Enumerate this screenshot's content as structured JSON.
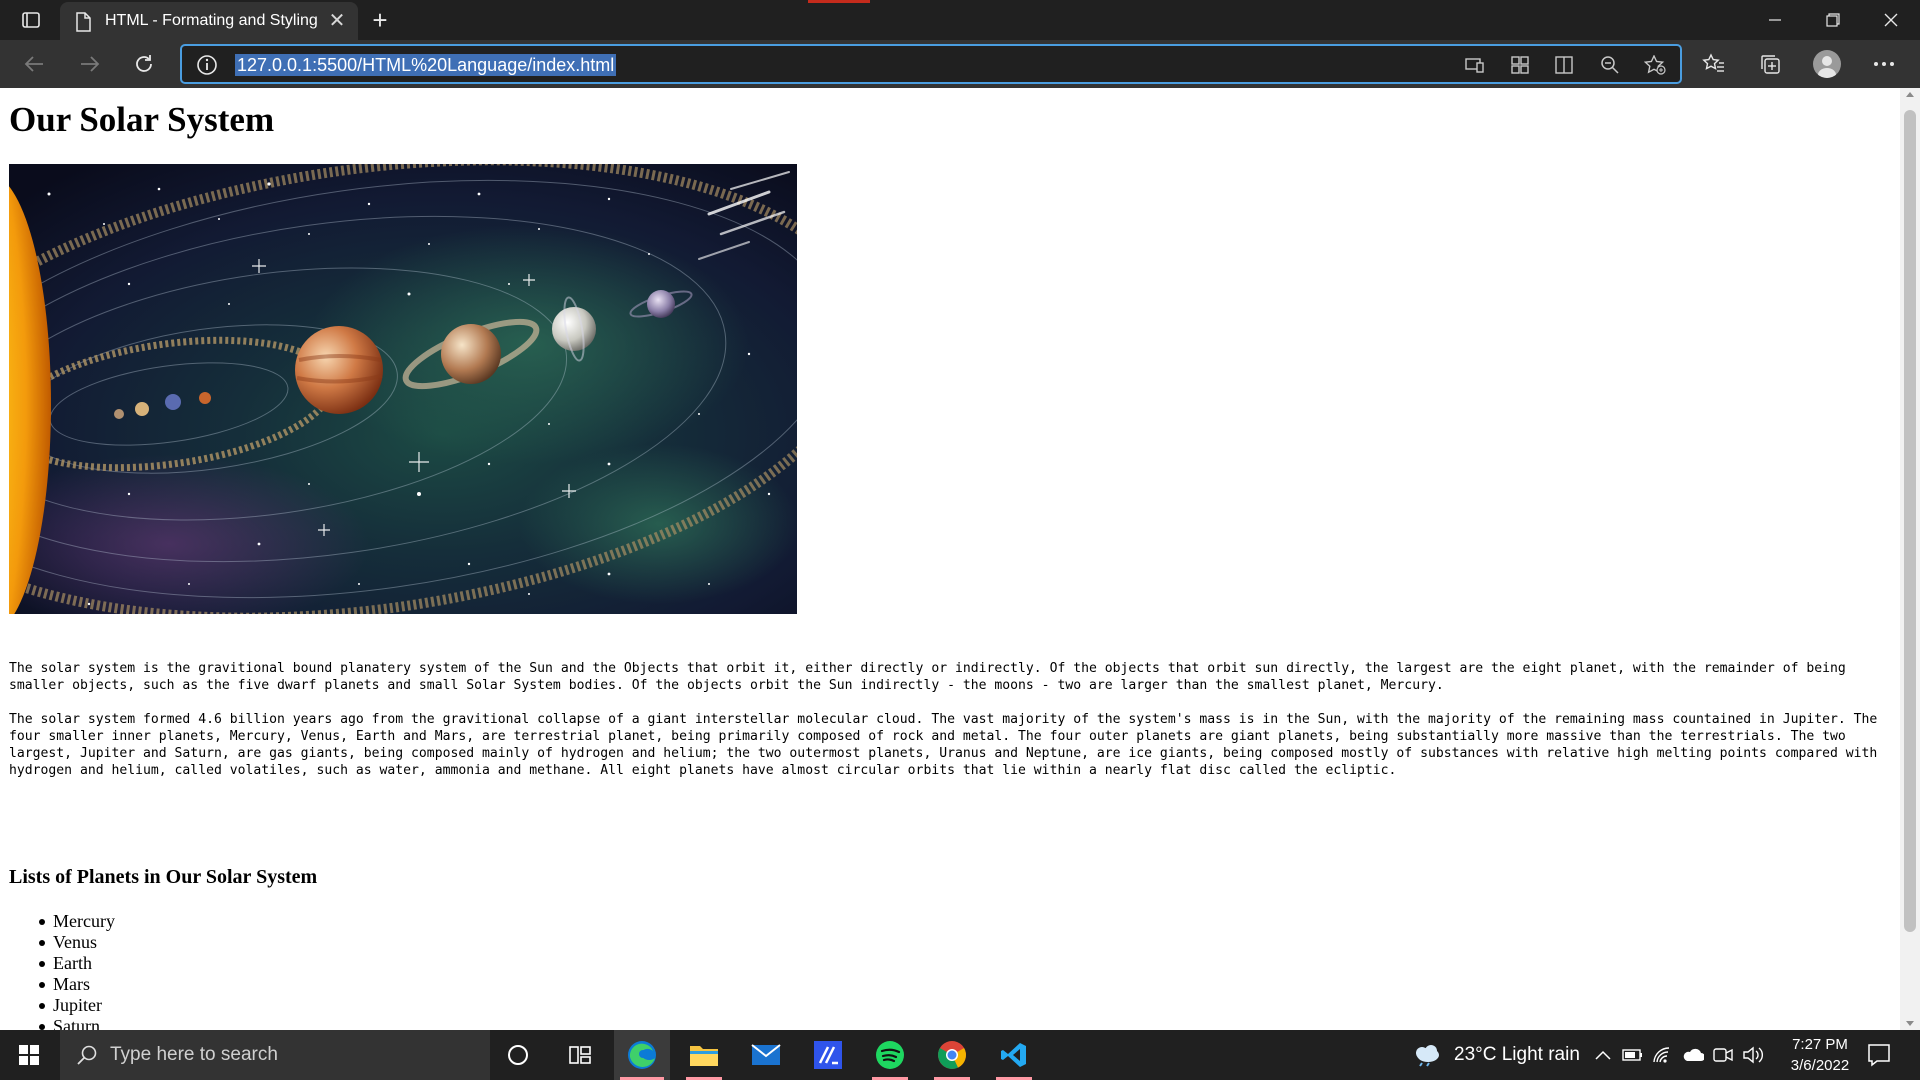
{
  "browser": {
    "tab_title": "HTML - Formating and Styling",
    "tab_close": "✕",
    "new_tab": "+",
    "url": "127.0.0.1:5500/HTML%20Language/index.html"
  },
  "page": {
    "title": "Our Solar System",
    "paragraphs": [
      "The solar system is the gravitional bound planatery system of the Sun and the Objects that orbit it, either directly or indirectly. Of the objects that orbit sun directly, the largest are the eight planet, with the remainder of being smaller objects, such as the five dwarf planets and small Solar System bodies. Of the objects orbit the Sun indirectly - the moons - two are larger than the smallest planet, Mercury.",
      "The solar system formed 4.6 billion years ago from the gravitional collapse of a giant interstellar molecular cloud. The vast majority of the system's mass is in the Sun, with the majority of the remaining mass countained in Jupiter. The four smaller inner planets, Mercury, Venus, Earth and Mars, are terrestrial planet, being primarily composed of rock and metal. The four outer planets are giant planets, being substantially more massive than the terrestrials. The two largest, Jupiter and Saturn, are gas giants, being composed mainly of hydrogen and helium; the two outermost planets, Uranus and Neptune, are ice giants, being composed mostly of substances with relative high melting points compared with hydrogen and helium, called volatiles, such as water, ammonia and methane. All eight planets have almost circular orbits that lie within a nearly flat disc called the ecliptic."
    ],
    "list_heading": "Lists of Planets in Our Solar System",
    "planets": [
      "Mercury",
      "Venus",
      "Earth",
      "Mars",
      "Jupiter",
      "Saturn"
    ]
  },
  "taskbar": {
    "search_placeholder": "Type here to search",
    "weather": "23°C  Light rain",
    "time": "7:27 PM",
    "date": "3/6/2022"
  },
  "colors": {
    "tabbar_bg": "#202020",
    "toolbar_bg": "#333333",
    "address_focus": "#4a9de0",
    "url_selection": "#3f6fb5",
    "taskbar_accent": "#ff99a4"
  }
}
